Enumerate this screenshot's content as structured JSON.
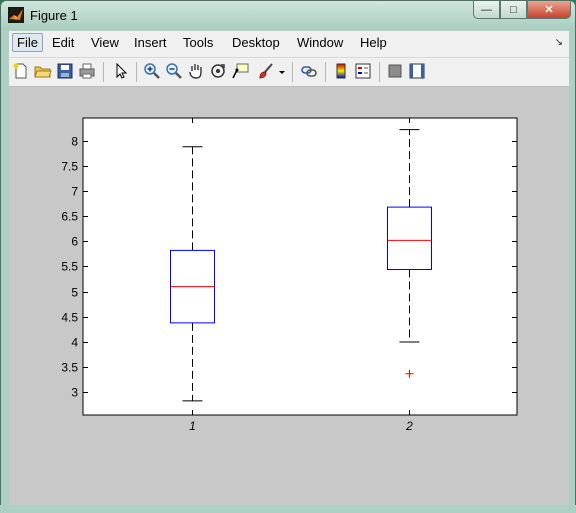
{
  "window": {
    "title": "Figure 1",
    "buttons": {
      "minimize": "—",
      "maximize": "□",
      "close": "✕"
    }
  },
  "menubar": {
    "items": [
      "File",
      "Edit",
      "View",
      "Insert",
      "Tools",
      "Desktop",
      "Window",
      "Help"
    ],
    "active": "File",
    "dock_glyph": "↘"
  },
  "toolbar": {
    "icons": [
      "new-figure-icon",
      "open-folder-icon",
      "save-icon",
      "print-icon",
      "pointer-icon",
      "zoom-in-icon",
      "zoom-out-icon",
      "pan-hand-icon",
      "rotate-3d-icon",
      "data-cursor-icon",
      "brush-icon",
      "brush-dropdown-icon",
      "link-plot-icon",
      "colorbar-icon",
      "legend-icon",
      "hide-plot-tools-icon",
      "show-plot-tools-icon"
    ]
  },
  "chart_data": {
    "type": "boxplot",
    "categories": [
      "1",
      "2"
    ],
    "boxes": [
      {
        "label": "1",
        "min": 2.83,
        "q1": 4.38,
        "median": 5.1,
        "q3": 5.82,
        "max": 7.88,
        "outliers": []
      },
      {
        "label": "2",
        "min": 4.0,
        "q1": 5.44,
        "median": 6.02,
        "q3": 6.68,
        "max": 8.22,
        "outliers": [
          3.37
        ]
      }
    ],
    "yticks": [
      "3",
      "3.5",
      "4",
      "4.5",
      "5",
      "5.5",
      "6",
      "6.5",
      "7",
      "7.5",
      "8"
    ],
    "ylim": [
      2.55,
      8.45
    ],
    "xlim": [
      0.5,
      2.5
    ],
    "title": "",
    "xlabel": "",
    "ylabel": "",
    "grid": false,
    "colors": {
      "box": "#0000ff",
      "median": "#ff0000",
      "whisker": "#000000",
      "outlier": "#ff0000",
      "axes_bg": "#ffffff",
      "figure_bg": "#c8c8c8"
    }
  }
}
